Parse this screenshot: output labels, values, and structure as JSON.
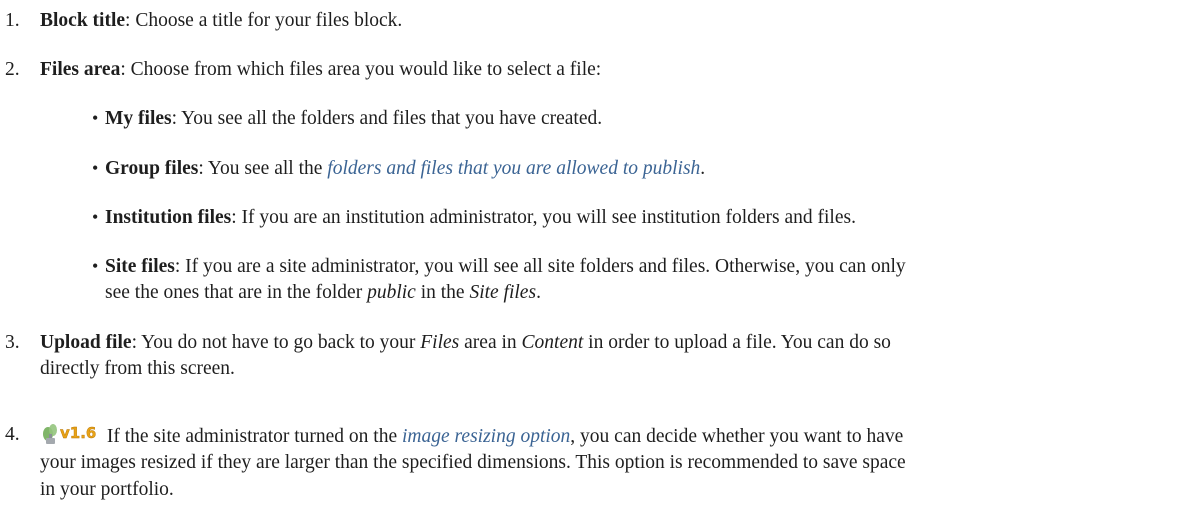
{
  "items": [
    {
      "num": "1.",
      "term": "Block title",
      "text": ": Choose a title for your files block."
    },
    {
      "num": "2.",
      "term": "Files area",
      "text": ": Choose from which files area you would like to select a file:"
    },
    {
      "num": "3.",
      "term": "Upload file",
      "text_a": ": You do not have to go back to your ",
      "text_files": "Files",
      "text_b": " area in ",
      "text_content": "Content",
      "text_c": " in order to upload a file. You can do so",
      "line2": "directly from this screen."
    },
    {
      "num": "4.",
      "badge": "v1.6",
      "text_a": " If the site administrator turned on the ",
      "link": "image resizing option",
      "text_b": ", you can decide whether you want to have",
      "line2": "your images resized if they are larger than the specified dimensions. This option is recommended to save space",
      "line3": "in your portfolio."
    }
  ],
  "subitems": [
    {
      "bullet": "•",
      "term": "My files",
      "text": ": You see all the folders and files that you have created."
    },
    {
      "bullet": "•",
      "term": "Group files",
      "text_a": ": You see all the ",
      "link": "folders and files that you are allowed to publish",
      "text_b": "."
    },
    {
      "bullet": "•",
      "term": "Institution files",
      "text": ": If you are an institution administrator, you will see institution folders and files."
    },
    {
      "bullet": "•",
      "term": "Site files",
      "text": ": If you are a site administrator, you will see all site folders and files. Otherwise, you can only",
      "line2_a": "see the ones that are in the folder ",
      "line2_public": "public",
      "line2_b": " in the ",
      "line2_site": "Site files",
      "line2_c": "."
    }
  ],
  "colors": {
    "link": "#3b6494",
    "badge_text": "#e8a317"
  }
}
